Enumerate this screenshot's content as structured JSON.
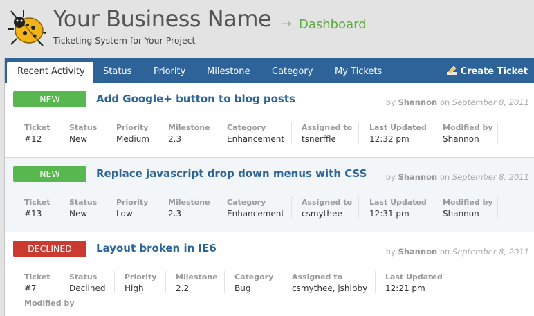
{
  "brand": {
    "title": "Your Business Name",
    "arrow": "→",
    "page": "Dashboard",
    "subtitle": "Ticketing System for Your Project"
  },
  "tabs": [
    {
      "label": "Recent Activity",
      "active": true
    },
    {
      "label": "Status"
    },
    {
      "label": "Priority"
    },
    {
      "label": "Milestone"
    },
    {
      "label": "Category"
    },
    {
      "label": "My Tickets"
    }
  ],
  "create_ticket_label": "Create Ticket",
  "ticket_field_labels": {
    "ticket": "Ticket",
    "status": "Status",
    "priority": "Priority",
    "milestone": "Milestone",
    "category": "Category",
    "assigned_to": "Assigned to",
    "last_updated": "Last Updated",
    "modified_by": "Modified by"
  },
  "tickets": [
    {
      "badge": "NEW",
      "title": "Add Google+ button to blog posts",
      "by_prefix": "by",
      "author": "Shannon",
      "on_prefix": "on",
      "date": "September 8, 2011",
      "ticket": "#12",
      "status": "New",
      "priority": "Medium",
      "milestone": "2.3",
      "category": "Enhancement",
      "assigned_to": "tsnerffle",
      "last_updated": "12:32 pm",
      "modified_by": "Shannon"
    },
    {
      "badge": "NEW",
      "title": "Replace javascript drop down menus with CSS",
      "by_prefix": "by",
      "author": "Shannon",
      "on_prefix": "on",
      "date": "September 8, 2011",
      "ticket": "#13",
      "status": "New",
      "priority": "Low",
      "milestone": "2.3",
      "category": "Enhancement",
      "assigned_to": "csmythee",
      "last_updated": "12:31 pm",
      "modified_by": "Shannon"
    },
    {
      "badge": "DECLINED",
      "title": "Layout broken in IE6",
      "by_prefix": "by",
      "author": "Shannon",
      "on_prefix": "on",
      "date": "September 8, 2011",
      "ticket": "#7",
      "status": "Declined",
      "priority": "High",
      "milestone": "2.2",
      "category": "Bug",
      "assigned_to": "csmythee, jshibby",
      "last_updated": "12:21 pm",
      "modified_by": ""
    }
  ],
  "colors": {
    "nav": "#2e6399",
    "badge_new": "#58b74f",
    "badge_declined": "#cb3a2f",
    "title_link": "#2d6597",
    "dashboard": "#5cae3e"
  },
  "icons": [
    "ladybug-logo-icon",
    "pencil-icon"
  ]
}
